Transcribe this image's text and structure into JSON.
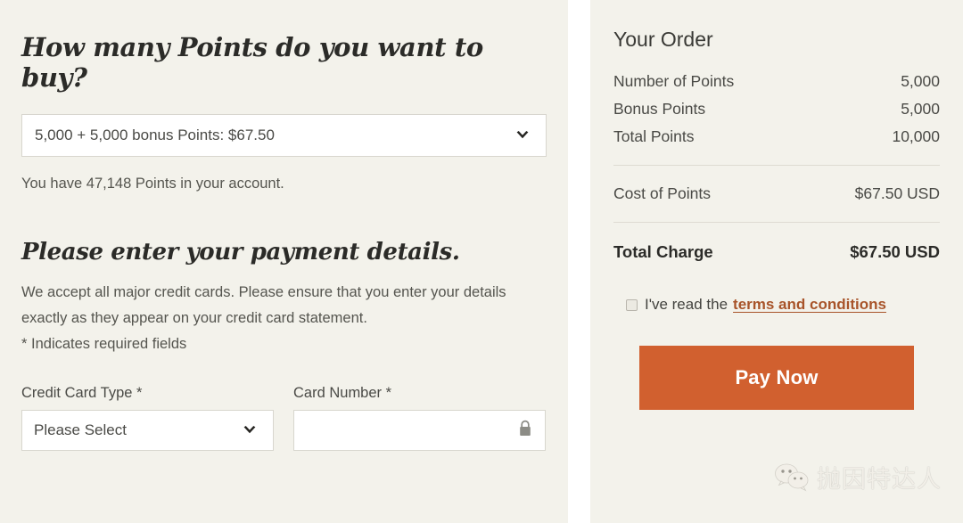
{
  "left": {
    "heading_buy": "How many Points do you want to buy?",
    "points_select": {
      "value": "5,000 + 5,000 bonus Points: $67.50",
      "icon": "chevron-down-icon"
    },
    "balance_note": "You have 47,148 Points in your account.",
    "heading_payment": "Please enter your payment details.",
    "payment_paragraph": "We accept all major credit cards. Please ensure that you enter your details exactly as they appear on your credit card statement.",
    "required_note": "* Indicates required fields",
    "fields": [
      {
        "label": "Credit Card Type *",
        "value": "Please Select",
        "icon": "chevron-down-icon",
        "type": "select"
      },
      {
        "label": "Card Number *",
        "value": "",
        "icon": "lock-icon",
        "type": "text"
      }
    ]
  },
  "order": {
    "title": "Your Order",
    "rows": [
      {
        "label": "Number of Points",
        "value": "5,000"
      },
      {
        "label": "Bonus Points",
        "value": "5,000"
      },
      {
        "label": "Total Points",
        "value": "10,000"
      }
    ],
    "cost": {
      "label": "Cost of Points",
      "value": "$67.50 USD"
    },
    "total": {
      "label": "Total Charge",
      "value": "$67.50 USD"
    },
    "terms": {
      "checked": false,
      "text": "I've read the",
      "link": "terms and conditions"
    },
    "pay_button": "Pay Now"
  },
  "watermark": {
    "text": "抛因特达人",
    "icon": "wechat-icon"
  },
  "colors": {
    "panel_bg": "#f3f2eb",
    "accent_orange": "#d1602f",
    "link_brown": "#a8542a",
    "heading": "#2b2b28",
    "body_text": "#55554f",
    "border": "#d8d6ce"
  }
}
